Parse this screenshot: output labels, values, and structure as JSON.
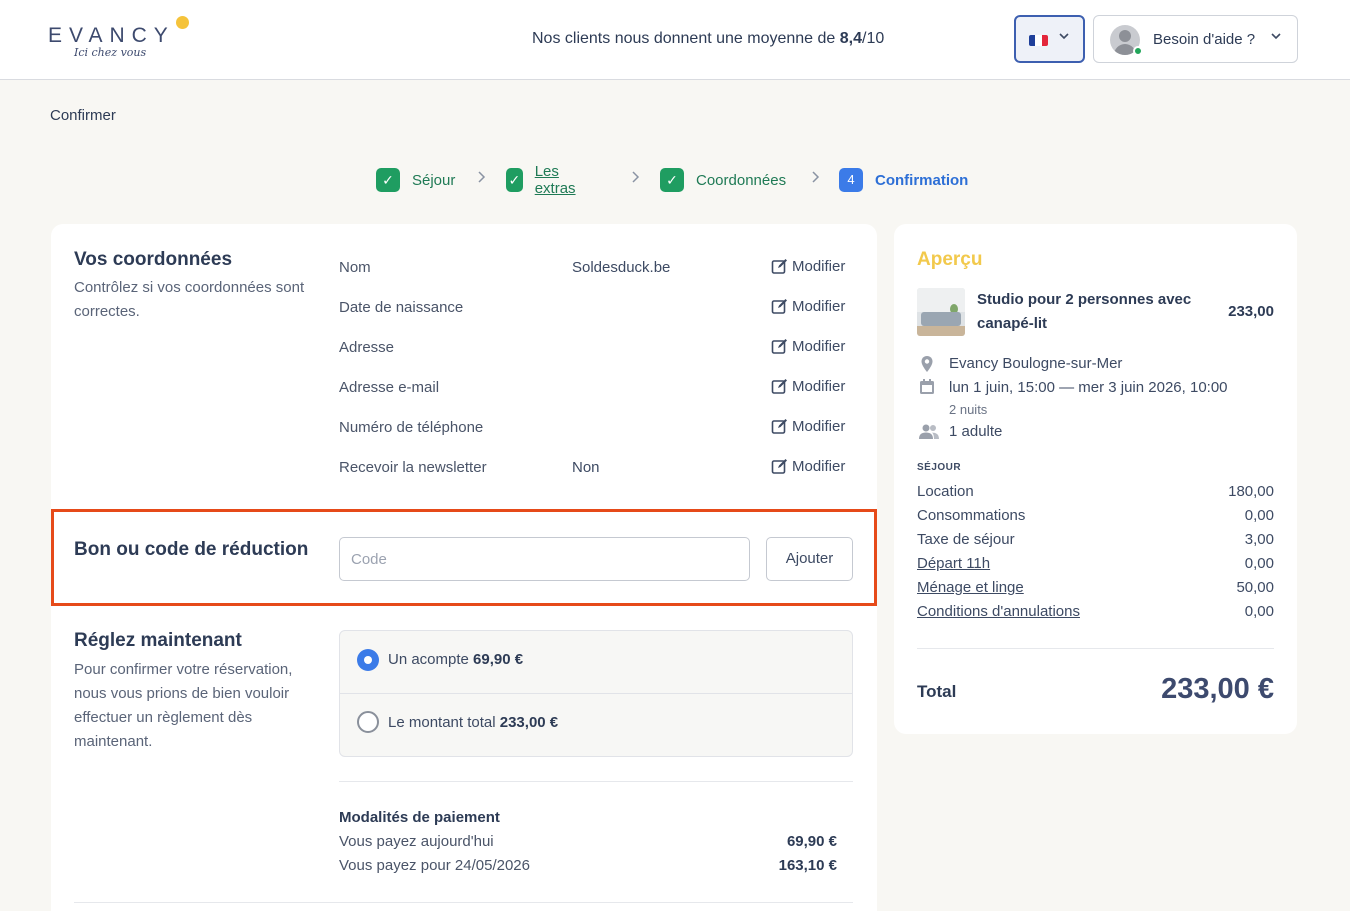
{
  "header": {
    "logo_text": "EVANCY",
    "logo_tagline": "Ici chez vous",
    "rating_prefix": "Nos clients nous donnent une moyenne de ",
    "rating_score": "8,4",
    "rating_suffix": "/10",
    "language_flag": "fr-flag-icon",
    "help_label": "Besoin d'aide ?"
  },
  "breadcrumb": "Confirmer",
  "steps": [
    {
      "label": "Séjour",
      "state": "done"
    },
    {
      "label": "Les extras",
      "state": "done"
    },
    {
      "label": "Coordonnées",
      "state": "done"
    },
    {
      "label": "Confirmation",
      "state": "active",
      "number": "4"
    }
  ],
  "contact": {
    "title": "Vos coordonnées",
    "description": "Contrôlez si vos coordonnées sont correctes.",
    "modify_label": "Modifier",
    "fields": [
      {
        "label": "Nom",
        "value": "Soldesduck.be"
      },
      {
        "label": "Date de naissance",
        "value": ""
      },
      {
        "label": "Adresse",
        "value": ""
      },
      {
        "label": "Adresse e-mail",
        "value": ""
      },
      {
        "label": "Numéro de téléphone",
        "value": ""
      },
      {
        "label": "Recevoir la newsletter",
        "value": "Non"
      }
    ]
  },
  "promo": {
    "title": "Bon ou code de réduction",
    "placeholder": "Code",
    "value": "",
    "button_label": "Ajouter"
  },
  "payment": {
    "title": "Réglez maintenant",
    "description": "Pour confirmer votre réservation, nous vous prions de bien vouloir effectuer un règlement dès maintenant.",
    "options": [
      {
        "label": "Un acompte ",
        "amount": "69,90 €",
        "selected": true
      },
      {
        "label": "Le montant total ",
        "amount": "233,00 €",
        "selected": false
      }
    ],
    "modalities_title": "Modalités de paiement",
    "modalities": [
      {
        "label": "Vous payez aujourd'hui",
        "amount": "69,90 €"
      },
      {
        "label": "Vous payez pour 24/05/2026",
        "amount": "163,10 €"
      }
    ]
  },
  "overview": {
    "title": "Aperçu",
    "room_name": "Studio pour 2 personnes avec canapé-lit",
    "room_price": "233,00",
    "location": "Evancy Boulogne-sur-Mer",
    "dates": "lun 1 juin, 15:00 — mer 3 juin 2026, 10:00",
    "nights": "2 nuits",
    "guests": "1 adulte",
    "section_label": "SÉJOUR",
    "lines": [
      {
        "label": "Location",
        "amount": "180,00",
        "link": false
      },
      {
        "label": "Consommations",
        "amount": "0,00",
        "link": false
      },
      {
        "label": "Taxe de séjour",
        "amount": "3,00",
        "link": false
      },
      {
        "label": "Départ 11h",
        "amount": "0,00",
        "link": true
      },
      {
        "label": "Ménage et linge",
        "amount": "50,00",
        "link": true
      },
      {
        "label": "Conditions d'annulations",
        "amount": "0,00",
        "link": true
      }
    ],
    "total_label": "Total",
    "total_amount": "233,00 €"
  },
  "colors": {
    "success_green": "#1f9d61",
    "active_blue": "#3b7be8",
    "accent_yellow": "#f2c94c",
    "highlight_red": "#e64a19"
  }
}
